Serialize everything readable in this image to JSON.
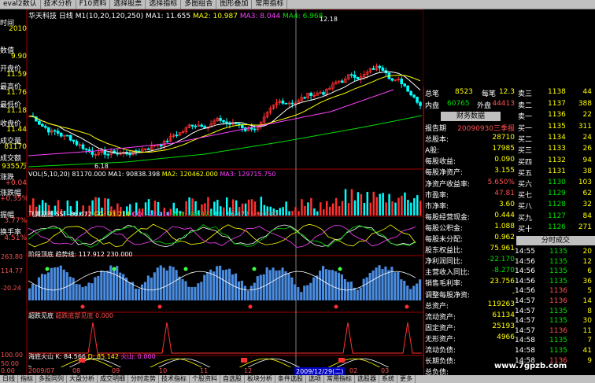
{
  "menu": [
    "eval2数认",
    "技术分析",
    "F10资料",
    "选择股票",
    "选择指标",
    "多图组合",
    "图形叠加",
    "常用指标"
  ],
  "main_legend": {
    "name": "华天科技",
    "period": "日线",
    "params": "M1(10,20,120,250)",
    "ma1": "MA1: 11.655",
    "ma2": "MA2: 10.987",
    "ma3": "MA3: 8.044",
    "ma4": "MA4: 6.968"
  },
  "price_labels": {
    "high": "12.18",
    "low": "6.18"
  },
  "left": [
    {
      "k": "时间",
      "v": "2010"
    },
    {
      "k": "数值",
      "v": "9.90"
    },
    {
      "k": "开盘价",
      "v": "11.59"
    },
    {
      "k": "最高价",
      "v": "11.76"
    },
    {
      "k": "最低价",
      "v": "11.18"
    },
    {
      "k": "收盘价",
      "v": "11.44"
    },
    {
      "k": "成交量",
      "v": "81170"
    },
    {
      "k": "成交额",
      "v": "9355万"
    },
    {
      "k": "涨跌",
      "v": "+0.04"
    },
    {
      "k": "涨跌幅",
      "v": "+0.35%"
    },
    {
      "k": "振幅",
      "v": "3.77%"
    },
    {
      "k": "换手率",
      "v": "4.51%"
    }
  ],
  "vol_legend": {
    "name": "VOL(5,10,20)",
    "vol": "81170.000",
    "ma1": "MA1: 90838.398",
    "ma2": "MA2: 120462.000",
    "ma3": "MA3: 129715.750"
  },
  "kdj_legend": {
    "name": "飞翼副图",
    "a": "SS: -86.472",
    "b": "GG: 93.214",
    "c": "QQ: -93.214",
    "d": "WW: -86.472",
    "e": "EE: 86.472",
    "f": "S: 0.000"
  },
  "stage_legend": {
    "name": "阶段顶底",
    "t": "趋势线: 117.912",
    "v": "230.000"
  },
  "stage_axis": {
    "top": "263.80",
    "mid": "114.77",
    "bot": "-20.24"
  },
  "oversold_legend": {
    "name": "超跌见底",
    "a": "超跌底部见底",
    "v": "0.000"
  },
  "bottom_legend": {
    "name": "海底火山",
    "k": "K: 84.566",
    "d": "D: 85.142",
    "f": "火山: 0.000"
  },
  "bottom_axis": {
    "top": "100.00",
    "mid": "50.00",
    "bot": "0.00"
  },
  "date_axis": [
    "2009/07",
    "08",
    "09",
    "10",
    "11",
    "12",
    "2009/12/29(二)",
    "02",
    "03"
  ],
  "orderbook": {
    "total_label": "总笔",
    "total": "8523",
    "per_label": "每笔",
    "per": "12.3",
    "in_label": "内盘",
    "in": "60765",
    "out_label": "外盘",
    "out": "44413"
  },
  "asks": [
    {
      "l": "卖三",
      "p": "1138",
      "v": "44"
    },
    {
      "l": "卖二",
      "p": "1137",
      "v": "388"
    },
    {
      "l": "卖一",
      "p": "1136",
      "v": "22"
    }
  ],
  "bids": [
    {
      "l": "买一",
      "p": "1135",
      "v": "311"
    },
    {
      "l": "买二",
      "p": "1134",
      "v": "24"
    },
    {
      "l": "买三",
      "p": "1133",
      "v": "26"
    },
    {
      "l": "买四",
      "p": "1132",
      "v": "94"
    },
    {
      "l": "买五",
      "p": "1131",
      "v": "38"
    },
    {
      "l": "买六",
      "p": "1130",
      "v": "103"
    },
    {
      "l": "买七",
      "p": "1129",
      "v": "62"
    },
    {
      "l": "买八",
      "p": "1128",
      "v": "32"
    },
    {
      "l": "买九",
      "p": "1127",
      "v": "84"
    },
    {
      "l": "买十",
      "p": "1126",
      "v": "271"
    }
  ],
  "fin_header": "财务数据",
  "fin": [
    {
      "k": "报告期",
      "v": "20090930三季报"
    },
    {
      "k": "总股本:",
      "v": "28710"
    },
    {
      "k": "A股:",
      "v": "17985"
    },
    {
      "k": "每股收益:",
      "v": "0.090"
    },
    {
      "k": "每股净资产:",
      "v": "3.155"
    },
    {
      "k": "净资产收益率:",
      "v": "5.650%"
    },
    {
      "k": "市盈率:",
      "v": "47.81"
    },
    {
      "k": "市净率:",
      "v": "3.60"
    },
    {
      "k": "每股经营现金:",
      "v": "0.444"
    },
    {
      "k": "每股公积金:",
      "v": "1.088"
    },
    {
      "k": "每股未分配:",
      "v": "0.962"
    },
    {
      "k": "股东权益比:",
      "v": "75.961"
    },
    {
      "k": "净利润同比:",
      "v": "-22.170"
    },
    {
      "k": "主营收入同比:",
      "v": "-8.270"
    },
    {
      "k": "销售毛利率:",
      "v": "23.756"
    },
    {
      "k": "调整每股净资:",
      "v": "-"
    },
    {
      "k": "总资产:",
      "v": "119263"
    },
    {
      "k": "流动资产:",
      "v": "61134"
    },
    {
      "k": "固定资产:",
      "v": "25193"
    },
    {
      "k": "无形资产:",
      "v": "4966"
    },
    {
      "k": "流动负债:",
      "v": ""
    },
    {
      "k": "长期负债:",
      "v": ""
    },
    {
      "k": "总负债:",
      "v": ""
    }
  ],
  "ticks_header": "分时成交",
  "ticks": [
    {
      "t": "14:55",
      "p": "1135",
      "v": "20"
    },
    {
      "t": "14:56",
      "p": "1135",
      "v": "12"
    },
    {
      "t": "14:56",
      "p": "1135",
      "v": "6"
    },
    {
      "t": "14:56",
      "p": "1135",
      "v": "36"
    },
    {
      "t": "14:56",
      "p": "1136",
      "v": "5"
    },
    {
      "t": "14:57",
      "p": "1136",
      "v": "14"
    },
    {
      "t": "14:57",
      "p": "1135",
      "v": "8"
    },
    {
      "t": "14:57",
      "p": "1135",
      "v": "30"
    },
    {
      "t": "14:57",
      "p": "1136",
      "v": "11"
    },
    {
      "t": "14:58",
      "p": "1135",
      "v": "7"
    },
    {
      "t": "14:58",
      "p": "1135",
      "v": "41"
    },
    {
      "t": "14:58",
      "p": "1136",
      "v": "9"
    }
  ],
  "bottom_tabs": [
    "日线",
    "指标",
    "多股同列",
    "大盘分析",
    "成交明细",
    "分时走势",
    "技术指标",
    "个股资料",
    "自选股",
    "板块分析",
    "条件选股",
    "选项",
    "常用指标",
    "选股器",
    "系统",
    "更多"
  ],
  "watermark": "www.7gpzb.com",
  "colors": {
    "up": "#ff3030",
    "down": "#00ffff",
    "ma1": "#ffffff",
    "ma2": "#ffff00",
    "ma3": "#ff40ff",
    "ma4": "#00e000"
  }
}
